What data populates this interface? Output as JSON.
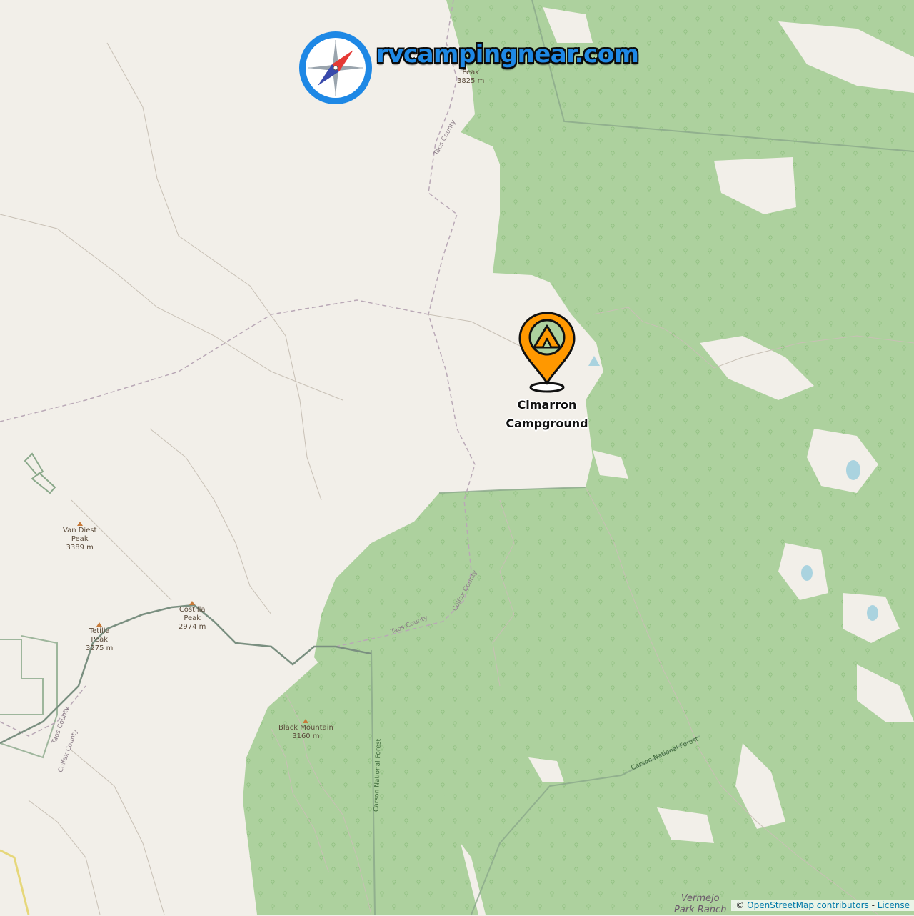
{
  "map": {
    "colors": {
      "land": "#f2efe9",
      "forest": "#add19e",
      "boundary": "#8a9a8a",
      "road": "#ffffff",
      "water": "#aad3df",
      "pin": "#ff9800"
    }
  },
  "logo": {
    "text": "rvcampingnear.com",
    "icon": "compass-icon"
  },
  "campground": {
    "name_line1": "Cimarron",
    "name_line2": "Campground",
    "icon": "tent-pin-icon"
  },
  "peaks": [
    {
      "name": "Peak",
      "elevation": "3825 m"
    },
    {
      "name": "Van Diest Peak",
      "line1": "Van Diest",
      "line2": "Peak",
      "elevation": "3389 m"
    },
    {
      "name": "Costilla Peak",
      "line1": "Costilla",
      "line2": "Peak",
      "elevation": "2974 m"
    },
    {
      "name": "Tetilla Peak",
      "line1": "Tetilla",
      "line2": "Peak",
      "elevation": "3275 m"
    },
    {
      "name": "Black Mountain",
      "line1": "Black Mountain",
      "elevation": "3160 m"
    }
  ],
  "boundaries": {
    "taos_top": "Taos County",
    "colfax_mid": "Colfax County",
    "taos_mid": "Taos County",
    "taos_left": "Taos County",
    "colfax_left": "Colfax County",
    "forest_vertical": "Carson National Forest",
    "forest_diagonal": "Carson National Forest"
  },
  "places": {
    "ranch_line1": "Vermejo",
    "ranch_line2": "Park Ranch"
  },
  "attribution": {
    "prefix": "© ",
    "osm": "OpenStreetMap contributors",
    "separator": " - ",
    "license": "License"
  }
}
